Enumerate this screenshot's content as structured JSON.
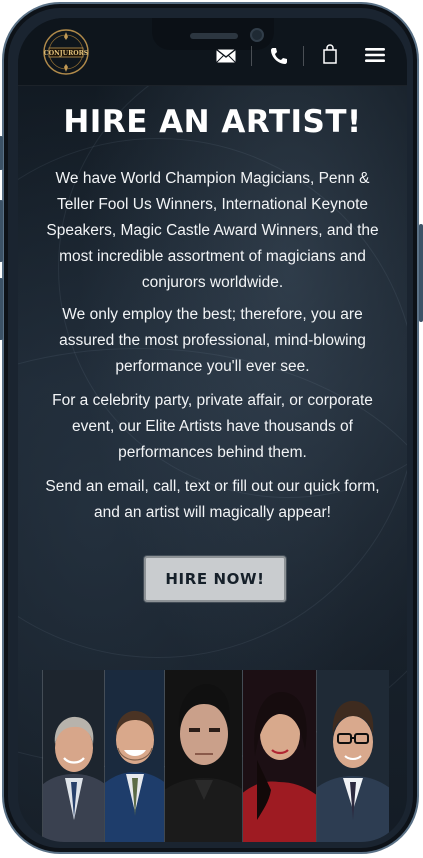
{
  "header": {
    "logo_alt": "Conjurors",
    "icons": [
      "envelope-icon",
      "phone-icon",
      "shopping-bag-icon",
      "hamburger-menu-icon"
    ]
  },
  "hero": {
    "title": "HIRE AN ARTIST!",
    "paragraphs": [
      "We have World Champion Magicians, Penn & Teller Fool Us Winners, International Keynote Speakers, Magic Castle Award Winners, and the most incredible assortment of magicians and conjurors worldwide.",
      "We only employ the best; therefore, you are assured the most professional, mind-blowing performance you'll ever see.",
      "For a celebrity party, private affair, or corporate event, our Elite Artists have thousands of performances behind them.",
      "Send an email, call, text or fill out our quick form, and an artist will magically appear!"
    ],
    "cta_label": "HIRE NOW!"
  },
  "artists": {
    "count": 5
  },
  "colors": {
    "background": "#141c25",
    "text": "#ffffff",
    "button": "#c9cccf",
    "button_text": "#16202a",
    "frame": "#5a7186"
  }
}
